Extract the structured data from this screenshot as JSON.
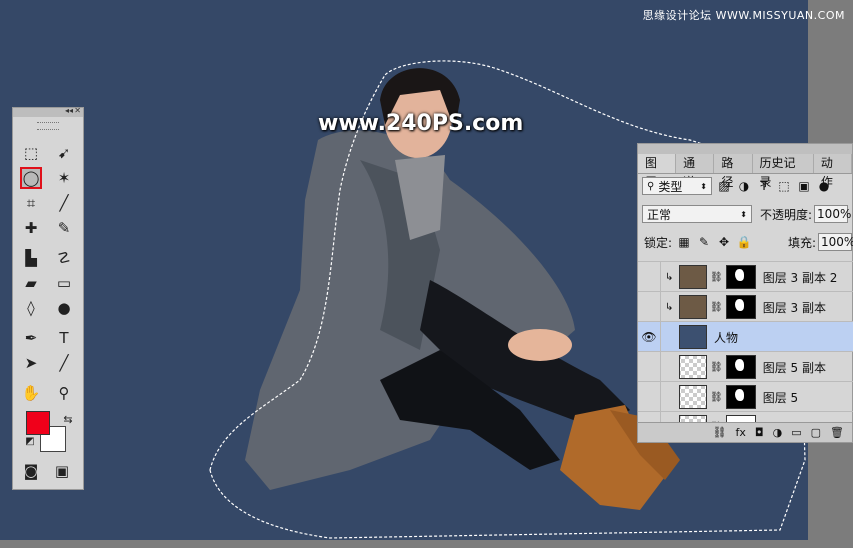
{
  "watermark": {
    "site_label": "思缘设计论坛 WWW.MISSYUAN.COM",
    "url": "www.240PS.com"
  },
  "toolbox": {
    "tools": [
      {
        "name": "rect-marquee-icon",
        "glyph": "⬚"
      },
      {
        "name": "move-icon",
        "glyph": "➹"
      },
      {
        "name": "lasso-icon",
        "glyph": "◯",
        "selected": true
      },
      {
        "name": "magic-wand-icon",
        "glyph": "✶"
      },
      {
        "name": "crop-icon",
        "glyph": "⌗"
      },
      {
        "name": "eyedropper-icon",
        "glyph": "╱"
      },
      {
        "name": "healing-icon",
        "glyph": "✚"
      },
      {
        "name": "brush-icon",
        "glyph": "✎"
      },
      {
        "name": "stamp-icon",
        "glyph": "▙"
      },
      {
        "name": "history-brush-icon",
        "glyph": "☡"
      },
      {
        "name": "eraser-icon",
        "glyph": "▰"
      },
      {
        "name": "gradient-icon",
        "glyph": "▭"
      },
      {
        "name": "blur-icon",
        "glyph": "◊"
      },
      {
        "name": "dodge-icon",
        "glyph": "●"
      },
      {
        "name": "pen-icon",
        "glyph": "✒"
      },
      {
        "name": "type-icon",
        "glyph": "T"
      },
      {
        "name": "path-select-icon",
        "glyph": "➤"
      },
      {
        "name": "line-icon",
        "glyph": "╱"
      },
      {
        "name": "hand-icon",
        "glyph": "✋"
      },
      {
        "name": "zoom-icon",
        "glyph": "⚲"
      }
    ],
    "foreground_color": "#f0001a",
    "background_color": "#ffffff"
  },
  "layers_panel": {
    "tabs": [
      "图层",
      "通道",
      "路径",
      "历史记录",
      "动作"
    ],
    "active_tab": "图层",
    "filter_label": "类型",
    "blend_mode": "正常",
    "opacity_label": "不透明度:",
    "opacity_value": "100%",
    "lock_label": "锁定:",
    "fill_label": "填充:",
    "fill_value": "100%",
    "layers": [
      {
        "name": "图层 3 副本 2",
        "visible": false,
        "clipped": true,
        "thumb": "tex",
        "mask": "black"
      },
      {
        "name": "图层 3 副本",
        "visible": false,
        "clipped": true,
        "thumb": "tex",
        "mask": "black"
      },
      {
        "name": "人物",
        "visible": true,
        "clipped": false,
        "thumb": "person",
        "mask": "none",
        "active": true
      },
      {
        "name": "图层 5 副本",
        "visible": false,
        "clipped": false,
        "thumb": "checker",
        "mask": "black"
      },
      {
        "name": "图层 5",
        "visible": false,
        "clipped": false,
        "thumb": "checker",
        "mask": "black"
      },
      {
        "name": "图层",
        "visible": false,
        "clipped": false,
        "thumb": "checker",
        "mask": "white"
      }
    ],
    "footer_icons": [
      "link-icon",
      "fx-icon",
      "add-mask-icon",
      "adjustment-icon",
      "folder-icon",
      "new-layer-icon",
      "trash-icon"
    ],
    "footer_glyphs": [
      "⛓",
      "fx",
      "◘",
      "◑",
      "▭",
      "▢",
      "🗑"
    ]
  }
}
